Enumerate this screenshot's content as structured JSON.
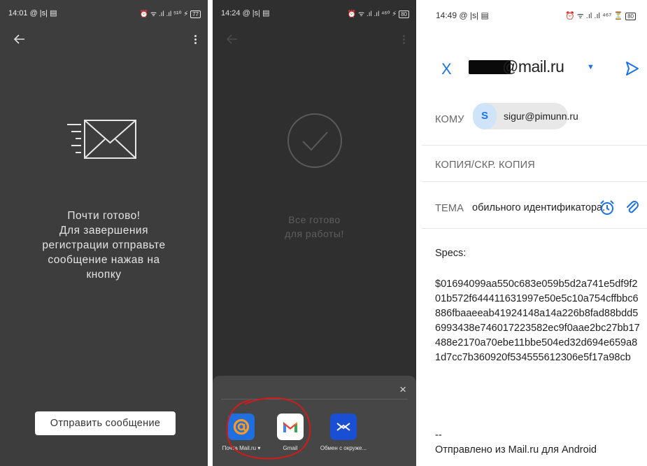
{
  "panel1": {
    "status": {
      "time": "14:01 @ |s| ▤",
      "icons": "⏰ ᯤ .ıl .ıl ⁵¹⁰ ⚡",
      "battery": "77"
    },
    "message_lines": [
      "Почти готово!",
      "Для завершения",
      "регистрации отправьте",
      "сообщение нажав на",
      "кнопку"
    ],
    "send_button": "Отправить сообщение"
  },
  "panel2": {
    "status": {
      "time": "14:24 @ |s| ▤",
      "icons": "⏰ ᯤ .ıl .ıl ⁴⁶⁰ ⚡",
      "battery": "80"
    },
    "message_lines": [
      "Все готово",
      "для работы!"
    ],
    "sheet": {
      "close": "×",
      "apps": [
        {
          "label": "Почта Mail.ru ▾",
          "icon": "mailru-icon"
        },
        {
          "label": "Gmail",
          "icon": "gmail-icon"
        },
        {
          "label": "Обмен с окруже...",
          "icon": "nearby-share-icon"
        }
      ]
    }
  },
  "panel3": {
    "status": {
      "time": "14:49 @ |s| ▤",
      "icons": "⏰ ᯤ .ıl .ıl ⁴⁶⁷ ⏳",
      "battery": "80"
    },
    "header": {
      "close": "X",
      "from": "@mail.ru"
    },
    "to_label": "КОМУ",
    "to_chip": {
      "avatar": "S",
      "email": "sigur@pimunn.ru"
    },
    "cc_label": "КОПИЯ/СКР. КОПИЯ",
    "subject_label": "ТЕМА",
    "subject_value": "обильного идентификатора.",
    "body_label": "Specs:",
    "body_hash": "$01694099aa550c683e059b5d2a741e5df9f201b572f644411631997e50e5c10a754cffbbc6886fbaaeeab41924148a14a226b8fad88bdd56993438e746017223582ec9f0aae2bc27bb17488e2170a70ebe11bbe504ed32d694e659a81d7cc7b360920f534555612306e5f17a98cb",
    "sig_dash": "--",
    "signature": "Отправлено из Mail.ru для Android"
  },
  "colors": {
    "accent_blue": "#1a73e8",
    "annotation_red": "#d11b1b"
  }
}
